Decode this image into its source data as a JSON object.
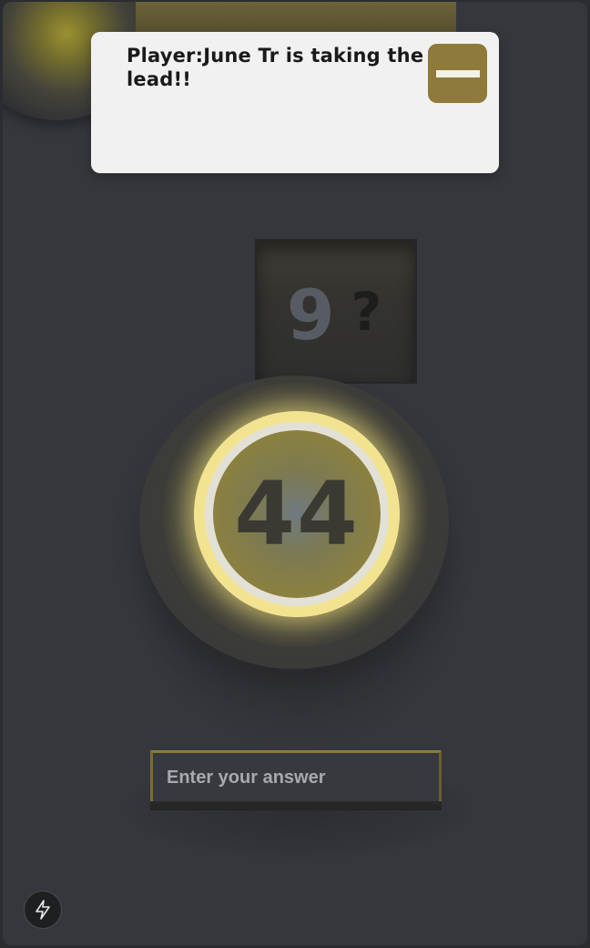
{
  "notification": {
    "message": "Player:June Tr is taking the lead!!",
    "close_icon": "minus-icon"
  },
  "question": {
    "digit": "9",
    "unknown": "?"
  },
  "dial": {
    "value": "44"
  },
  "answer": {
    "placeholder": "Enter your answer",
    "value": ""
  },
  "footer": {
    "action_icon": "lightning-bolt-icon"
  },
  "colors": {
    "background": "#36373c",
    "accent_gold": "#8e7a3a",
    "ring_glow": "#f2e391",
    "toast_bg": "#f1f1f1"
  }
}
